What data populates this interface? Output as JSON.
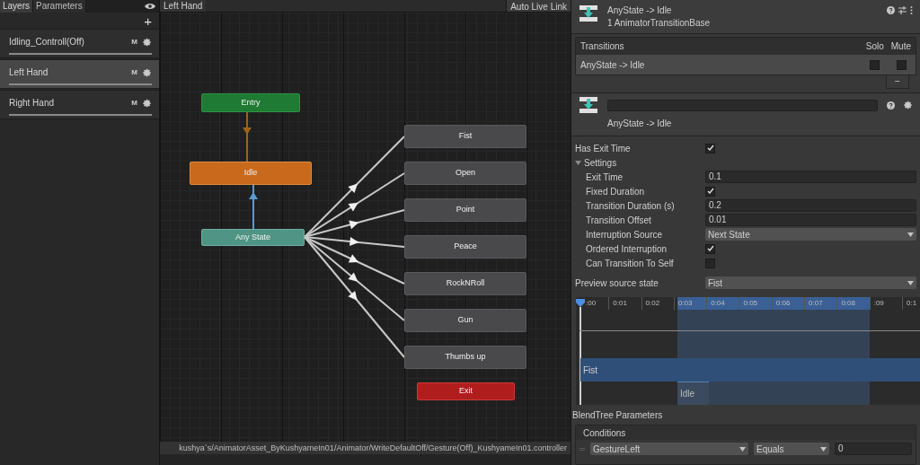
{
  "layers_panel": {
    "tabs": [
      {
        "label": "Layers",
        "selected": true
      },
      {
        "label": "Parameters",
        "selected": false
      }
    ],
    "add_button": "+",
    "layers": [
      {
        "name": "Idling_Controll(Off)",
        "badge": "M",
        "selected": false
      },
      {
        "name": "Left Hand",
        "badge": "M",
        "selected": true
      },
      {
        "name": "Right Hand",
        "badge": "M",
        "selected": false
      }
    ]
  },
  "graph": {
    "breadcrumb": "Left Hand",
    "live_link_button": "Auto Live Link",
    "nodes": [
      {
        "label": "Entry",
        "kind": "entry"
      },
      {
        "label": "Idle",
        "kind": "default"
      },
      {
        "label": "Any State",
        "kind": "any"
      },
      {
        "label": "Fist",
        "kind": "state"
      },
      {
        "label": "Open",
        "kind": "state"
      },
      {
        "label": "Point",
        "kind": "state"
      },
      {
        "label": "Peace",
        "kind": "state"
      },
      {
        "label": "RockNRoll",
        "kind": "state"
      },
      {
        "label": "Gun",
        "kind": "state"
      },
      {
        "label": "Thumbs up",
        "kind": "state"
      },
      {
        "label": "Exit",
        "kind": "exit"
      }
    ],
    "path": "kushya`s/AnimatorAsset_ByKushyameIn01/Animator/WriteDefaultOff/Gesture(Off)_KushyameIn01.controller"
  },
  "inspector": {
    "title": "AnyState -> Idle",
    "subtitle": "1 AnimatorTransitionBase",
    "transitions": {
      "header": "Transitions",
      "solo_header": "Solo",
      "mute_header": "Mute",
      "remove_button": "−",
      "rows": [
        {
          "label": "AnyState -> Idle",
          "solo": false,
          "mute": false,
          "selected": true
        }
      ]
    },
    "transition_caption": "AnyState -> Idle",
    "has_exit_time": {
      "label": "Has Exit Time",
      "checked": true
    },
    "settings": {
      "label": "Settings",
      "expanded": true,
      "children": [
        {
          "kind": "field",
          "label": "Exit Time",
          "value": "0.1"
        },
        {
          "kind": "checkbox",
          "label": "Fixed Duration",
          "checked": true
        },
        {
          "kind": "field",
          "label": "Transition Duration (s)",
          "value": "0.2"
        },
        {
          "kind": "field",
          "label": "Transition Offset",
          "value": "0.01"
        },
        {
          "kind": "dropdown",
          "label": "Interruption Source",
          "value": "Next State"
        },
        {
          "kind": "checkbox",
          "label": "Ordered Interruption",
          "checked": true
        },
        {
          "kind": "checkbox",
          "label": "Can Transition To Self",
          "checked": false
        }
      ]
    },
    "preview": {
      "label": "Preview source state",
      "value": "Fist"
    },
    "timeline": {
      "ticks": [
        ":00",
        "0:01",
        "0:02",
        "0:03",
        "0:04",
        "0:05",
        "0:06",
        "0:07",
        "0:08",
        ":09",
        "0:1"
      ],
      "source_clip": "Fist",
      "destination_clip": "Idle"
    },
    "blend_tree_label": "BlendTree Parameters",
    "conditions": {
      "header": "Conditions",
      "rows": [
        {
          "parameter": "GestureLeft",
          "mode": "Equals",
          "value": "0"
        }
      ]
    }
  }
}
